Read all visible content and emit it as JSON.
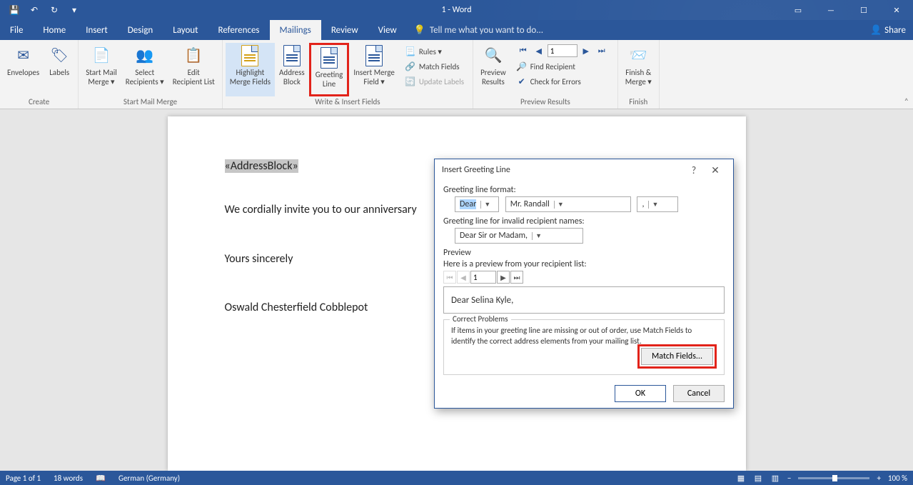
{
  "title": "1 - Word",
  "menutabs": {
    "file": "File",
    "home": "Home",
    "insert": "Insert",
    "design": "Design",
    "layout": "Layout",
    "references": "References",
    "mailings": "Mailings",
    "review": "Review",
    "view": "View",
    "tellme": "Tell me what you want to do...",
    "share": "Share"
  },
  "ribbon": {
    "create": {
      "envelopes": "Envelopes",
      "labels": "Labels",
      "group": "Create"
    },
    "smm": {
      "startmm": "Start Mail\nMerge ▾",
      "selrec": "Select\nRecipients ▾",
      "editrec": "Edit\nRecipient List",
      "group": "Start Mail Merge"
    },
    "write": {
      "highlight": "Highlight\nMerge Fields",
      "addrblock": "Address\nBlock",
      "greeting": "Greeting\nLine",
      "insmerge": "Insert Merge\nField ▾",
      "rules": "Rules ▾",
      "matchfields": "Match Fields",
      "updatelabels": "Update Labels",
      "group": "Write & Insert Fields"
    },
    "preview": {
      "preview": "Preview\nResults",
      "findrec": "Find Recipient",
      "checkerr": "Check for Errors",
      "rec": "1",
      "group": "Preview Results"
    },
    "finish": {
      "finish": "Finish &\nMerge ▾",
      "group": "Finish"
    }
  },
  "doc": {
    "addrblock": "«AddressBlock»",
    "body": "We cordially invite you to our anniversary",
    "close": "Yours sincerely",
    "sig": "Oswald Chesterfield Cobblepot"
  },
  "dialog": {
    "title": "Insert Greeting Line",
    "glf": "Greeting line format:",
    "salutation": "Dear",
    "name": "Mr. Randall",
    "punct": ",",
    "glinv": "Greeting line for invalid recipient names:",
    "invalid": "Dear Sir or Madam,",
    "preview": "Preview",
    "previewfrom": "Here is a preview from your recipient list:",
    "rec": "1",
    "previewtext": "Dear Selina Kyle,",
    "correct": "Correct Problems",
    "correcttxt": "If items in your greeting line are missing or out of order, use Match Fields to identify the correct address elements from your mailing list.",
    "matchbtn": "Match Fields...",
    "ok": "OK",
    "cancel": "Cancel"
  },
  "status": {
    "page": "Page 1 of 1",
    "words": "18 words",
    "lang": "German (Germany)",
    "zoom": "100 %"
  }
}
